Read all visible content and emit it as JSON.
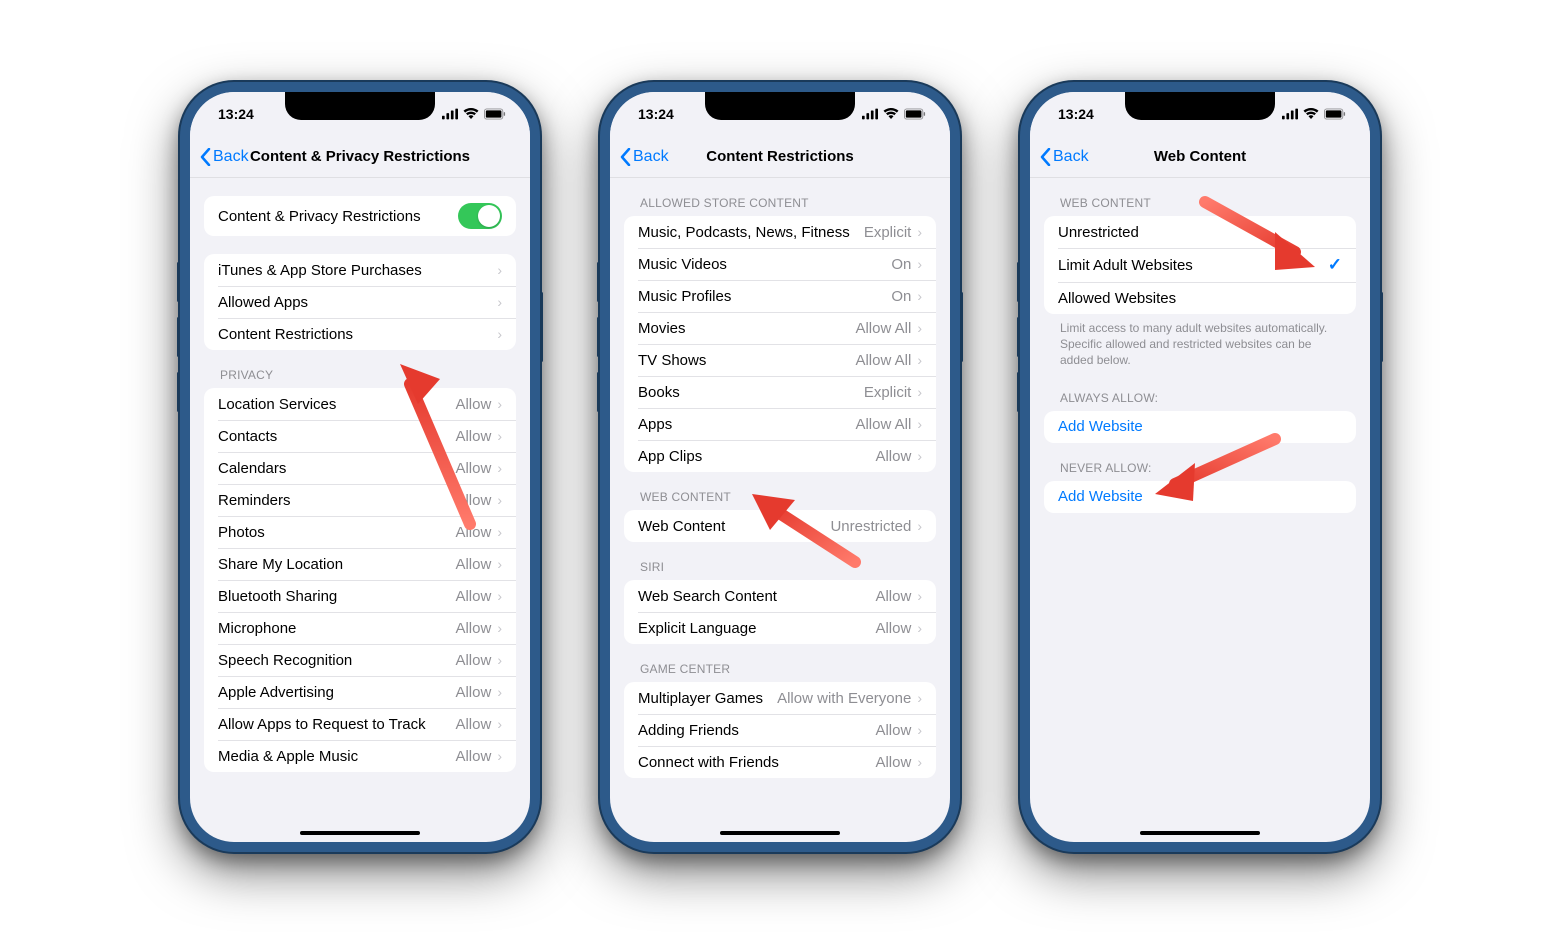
{
  "status": {
    "time": "13:24"
  },
  "nav_back": "Back",
  "phone1": {
    "title": "Content & Privacy Restrictions",
    "toggle_label": "Content & Privacy Restrictions",
    "store_rows": [
      {
        "label": "iTunes & App Store Purchases"
      },
      {
        "label": "Allowed Apps"
      },
      {
        "label": "Content Restrictions"
      }
    ],
    "privacy_header": "Privacy",
    "privacy_rows": [
      {
        "label": "Location Services",
        "value": "Allow"
      },
      {
        "label": "Contacts",
        "value": "Allow"
      },
      {
        "label": "Calendars",
        "value": "Allow"
      },
      {
        "label": "Reminders",
        "value": "Allow"
      },
      {
        "label": "Photos",
        "value": "Allow"
      },
      {
        "label": "Share My Location",
        "value": "Allow"
      },
      {
        "label": "Bluetooth Sharing",
        "value": "Allow"
      },
      {
        "label": "Microphone",
        "value": "Allow"
      },
      {
        "label": "Speech Recognition",
        "value": "Allow"
      },
      {
        "label": "Apple Advertising",
        "value": "Allow"
      },
      {
        "label": "Allow Apps to Request to Track",
        "value": "Allow"
      },
      {
        "label": "Media & Apple Music",
        "value": "Allow"
      }
    ]
  },
  "phone2": {
    "title": "Content Restrictions",
    "allowed_header": "Allowed Store Content",
    "allowed_rows": [
      {
        "label": "Music, Podcasts, News, Fitness",
        "value": "Explicit"
      },
      {
        "label": "Music Videos",
        "value": "On"
      },
      {
        "label": "Music Profiles",
        "value": "On"
      },
      {
        "label": "Movies",
        "value": "Allow All"
      },
      {
        "label": "TV Shows",
        "value": "Allow All"
      },
      {
        "label": "Books",
        "value": "Explicit"
      },
      {
        "label": "Apps",
        "value": "Allow All"
      },
      {
        "label": "App Clips",
        "value": "Allow"
      }
    ],
    "web_header": "Web Content",
    "web_rows": [
      {
        "label": "Web Content",
        "value": "Unrestricted"
      }
    ],
    "siri_header": "Siri",
    "siri_rows": [
      {
        "label": "Web Search Content",
        "value": "Allow"
      },
      {
        "label": "Explicit Language",
        "value": "Allow"
      }
    ],
    "gc_header": "Game Center",
    "gc_rows": [
      {
        "label": "Multiplayer Games",
        "value": "Allow with Everyone"
      },
      {
        "label": "Adding Friends",
        "value": "Allow"
      },
      {
        "label": "Connect with Friends",
        "value": "Allow"
      }
    ]
  },
  "phone3": {
    "title": "Web Content",
    "wc_header": "Web Content",
    "options": [
      {
        "label": "Unrestricted",
        "checked": false
      },
      {
        "label": "Limit Adult Websites",
        "checked": true
      },
      {
        "label": "Allowed Websites",
        "checked": false
      }
    ],
    "footer": "Limit access to many adult websites automatically. Specific allowed and restricted websites can be added below.",
    "always_header": "Always Allow:",
    "never_header": "Never Allow:",
    "add_website": "Add Website"
  }
}
